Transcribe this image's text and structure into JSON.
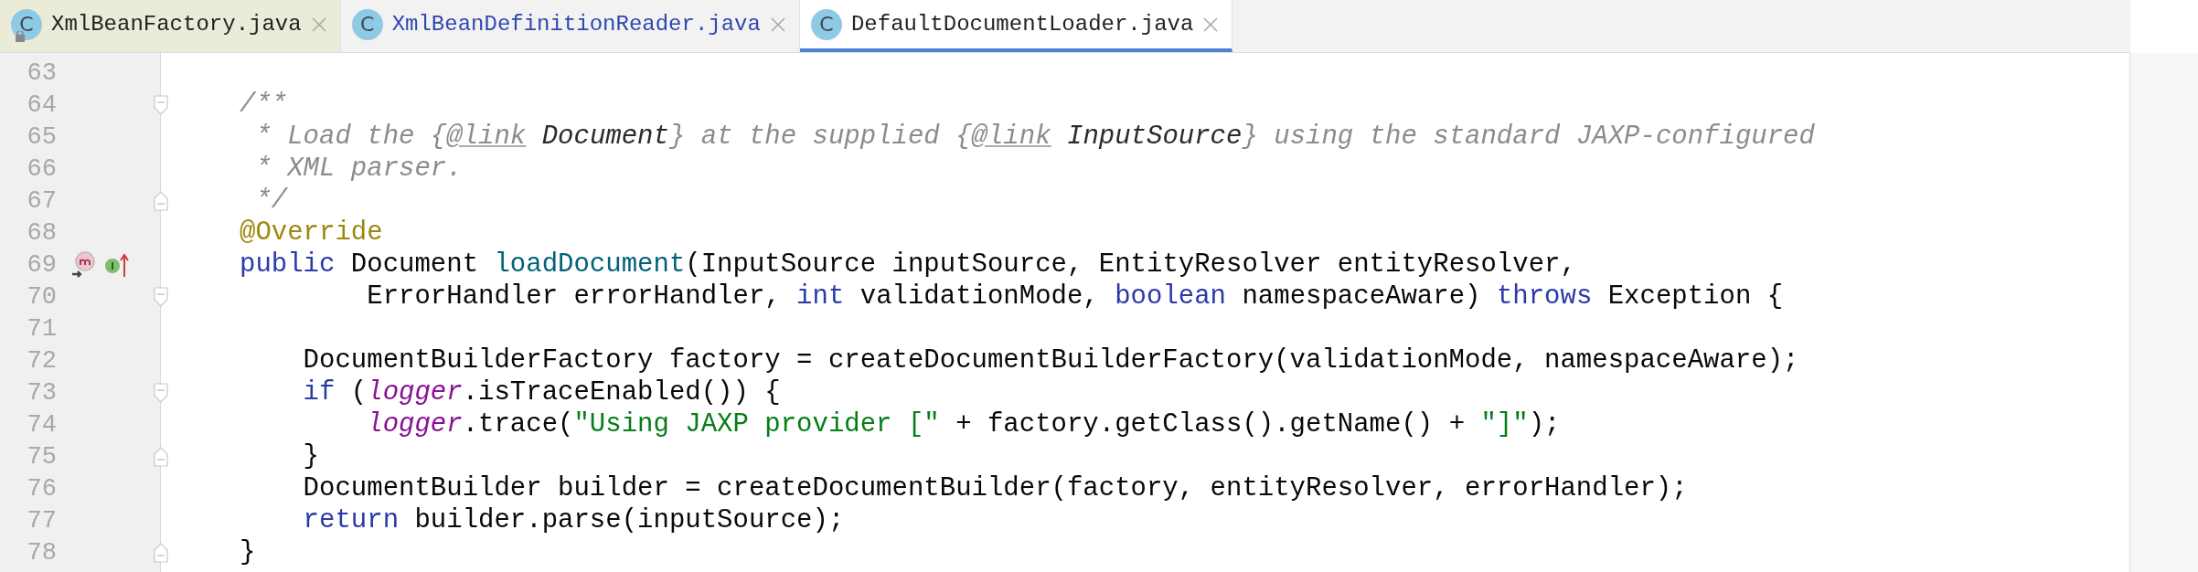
{
  "tabs": [
    {
      "icon_letter": "C",
      "label": "XmlBeanFactory.java",
      "read_only": true,
      "modified": false,
      "selected": false
    },
    {
      "icon_letter": "C",
      "label": "XmlBeanDefinitionReader.java",
      "read_only": false,
      "modified": true,
      "selected": false
    },
    {
      "icon_letter": "C",
      "label": "DefaultDocumentLoader.java",
      "read_only": false,
      "modified": false,
      "selected": true
    }
  ],
  "editor": {
    "lines": [
      {
        "number": "63"
      },
      {
        "number": "64",
        "fold_start": true,
        "tokens": [
          {
            "kind": "comment",
            "text": "/**"
          }
        ]
      },
      {
        "number": "65",
        "tokens": [
          {
            "kind": "comment",
            "text": " * Load the {"
          },
          {
            "kind": "doc-tag",
            "text": "@link"
          },
          {
            "kind": "doc-ref",
            "text": " Document"
          },
          {
            "kind": "comment",
            "text": "} at the supplied {"
          },
          {
            "kind": "doc-tag",
            "text": "@link"
          },
          {
            "kind": "doc-ref",
            "text": " InputSource"
          },
          {
            "kind": "comment",
            "text": "} using the standard JAXP-configured"
          }
        ]
      },
      {
        "number": "66",
        "tokens": [
          {
            "kind": "comment",
            "text": " * XML parser."
          }
        ]
      },
      {
        "number": "67",
        "fold_end": true,
        "tokens": [
          {
            "kind": "comment",
            "text": " */"
          }
        ]
      },
      {
        "number": "68",
        "tokens": [
          {
            "kind": "annotation",
            "text": "@Override"
          }
        ]
      },
      {
        "number": "69",
        "overrides": true,
        "implemented": true,
        "tokens": [
          {
            "kind": "keyword",
            "text": "public"
          },
          {
            "kind": "plain",
            "text": " Document "
          },
          {
            "kind": "method",
            "text": "loadDocument"
          },
          {
            "kind": "plain",
            "text": "(InputSource inputSource, EntityResolver entityResolver,"
          }
        ]
      },
      {
        "number": "70",
        "fold_start": true,
        "tokens": [
          {
            "kind": "plain",
            "text": "        ErrorHandler errorHandler, "
          },
          {
            "kind": "keyword",
            "text": "int"
          },
          {
            "kind": "plain",
            "text": " validationMode, "
          },
          {
            "kind": "keyword",
            "text": "boolean"
          },
          {
            "kind": "plain",
            "text": " namespaceAware) "
          },
          {
            "kind": "keyword",
            "text": "throws"
          },
          {
            "kind": "plain",
            "text": " Exception {"
          }
        ]
      },
      {
        "number": "71"
      },
      {
        "number": "72",
        "tokens": [
          {
            "kind": "plain",
            "text": "    DocumentBuilderFactory factory = createDocumentBuilderFactory(validationMode, namespaceAware);"
          }
        ]
      },
      {
        "number": "73",
        "fold_start": true,
        "tokens": [
          {
            "kind": "keyword",
            "text": "    if"
          },
          {
            "kind": "plain",
            "text": " ("
          },
          {
            "kind": "static-field",
            "text": "logger"
          },
          {
            "kind": "plain",
            "text": ".isTraceEnabled()) {"
          }
        ]
      },
      {
        "number": "74",
        "tokens": [
          {
            "kind": "static-field",
            "text": "        logger"
          },
          {
            "kind": "plain",
            "text": ".trace("
          },
          {
            "kind": "string",
            "text": "\"Using JAXP provider [\""
          },
          {
            "kind": "plain",
            "text": " + factory.getClass().getName() + "
          },
          {
            "kind": "string",
            "text": "\"]\""
          },
          {
            "kind": "plain",
            "text": ");"
          }
        ]
      },
      {
        "number": "75",
        "fold_end": true,
        "tokens": [
          {
            "kind": "plain",
            "text": "    }"
          }
        ]
      },
      {
        "number": "76",
        "tokens": [
          {
            "kind": "plain",
            "text": "    DocumentBuilder builder = createDocumentBuilder(factory, entityResolver, errorHandler);"
          }
        ]
      },
      {
        "number": "77",
        "tokens": [
          {
            "kind": "keyword",
            "text": "    return"
          },
          {
            "kind": "plain",
            "text": " builder.parse(inputSource);"
          }
        ]
      },
      {
        "number": "78",
        "fold_end": true,
        "tokens": [
          {
            "kind": "plain",
            "text": "}"
          }
        ]
      }
    ]
  }
}
